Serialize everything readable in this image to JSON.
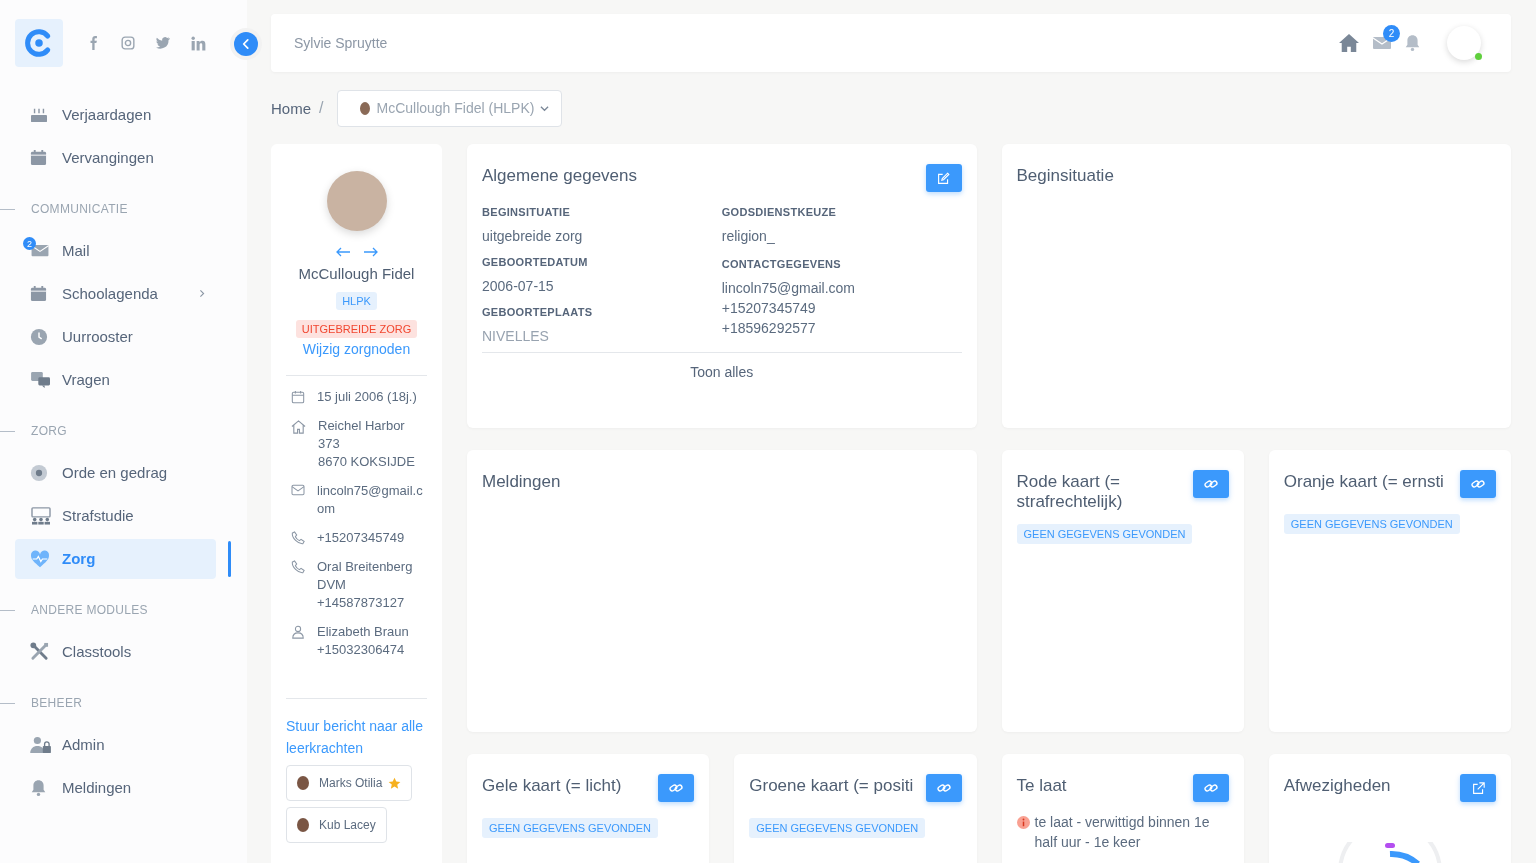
{
  "sidebar": {
    "sections": [
      {
        "items": [
          {
            "label": "Verjaardagen",
            "selected": false
          },
          {
            "label": "Vervangingen",
            "selected": false
          }
        ]
      },
      {
        "heading": "COMMUNICATIE",
        "items": [
          {
            "label": "Mail",
            "selected": false,
            "badge": "2"
          },
          {
            "label": "Schoolagenda",
            "selected": false,
            "submenu": true
          },
          {
            "label": "Uurrooster",
            "selected": false
          },
          {
            "label": "Vragen",
            "selected": false
          }
        ]
      },
      {
        "heading": "ZORG",
        "items": [
          {
            "label": "Orde en gedrag",
            "selected": false
          },
          {
            "label": "Strafstudie",
            "selected": false
          },
          {
            "label": "Zorg",
            "selected": true
          }
        ]
      },
      {
        "heading": "ANDERE MODULES",
        "items": [
          {
            "label": "Classtools",
            "selected": false
          }
        ]
      },
      {
        "heading": "BEHEER",
        "items": [
          {
            "label": "Admin",
            "selected": false
          },
          {
            "label": "Meldingen",
            "selected": false
          }
        ]
      }
    ]
  },
  "topbar": {
    "user": "Sylvie Spruytte",
    "mail_badge": "2"
  },
  "breadcrumb": {
    "home": "Home",
    "separator": "/",
    "student": "McCullough Fidel (HLPK)"
  },
  "profile": {
    "name": "McCullough Fidel",
    "class": "HLPK",
    "care_level": "UITGEBREIDE ZORG",
    "care_link": "Wijzig zorgnoden",
    "details": [
      {
        "kind": "date",
        "lines": [
          "15 juli 2006 (18j.)"
        ]
      },
      {
        "kind": "home",
        "lines": [
          "Reichel Harbor 373",
          "8670 KOKSIJDE"
        ]
      },
      {
        "kind": "mail",
        "lines": [
          "lincoln75@gmail.com"
        ]
      },
      {
        "kind": "phone",
        "lines": [
          "+15207345749"
        ]
      },
      {
        "kind": "phone",
        "lines": [
          "Oral Breitenberg DVM",
          "+14587873127"
        ]
      },
      {
        "kind": "person",
        "lines": [
          "Elizabeth Braun",
          "+15032306474"
        ]
      }
    ],
    "message_link": "Stuur bericht naar alle leerkrachten",
    "teachers": [
      {
        "name": "Marks Otilia",
        "starred": true
      },
      {
        "name": "Kub Lacey",
        "starred": false
      }
    ]
  },
  "general": {
    "title": "Algemene gegevens",
    "left": [
      {
        "label": "BEGINSITUATIE",
        "values": [
          "uitgebreide zorg"
        ]
      },
      {
        "label": "GEBOORTEDATUM",
        "values": [
          "2006-07-15"
        ]
      },
      {
        "label": "GEBOORTEPLAATS",
        "values": [
          "NIVELLES"
        ]
      }
    ],
    "right": [
      {
        "label": "GODSDIENSTKEUZE",
        "values": [
          "religion_"
        ]
      },
      {
        "label": "CONTACTGEGEVENS",
        "values": [
          "lincoln75@gmail.com",
          "+15207345749",
          "+18596292577"
        ]
      }
    ],
    "show_all": "Toon alles"
  },
  "beginsituatie": {
    "title": "Beginsituatie"
  },
  "meldingen": {
    "title": "Meldingen"
  },
  "cards": [
    {
      "kind": "list",
      "title": "Rode kaart (= strafrechtelijk)",
      "button": {
        "kind": "link"
      },
      "empty": "GEEN GEGEVENS GEVONDEN"
    },
    {
      "kind": "list",
      "title": "Oranje kaart (= ernsti",
      "button": {
        "kind": "link"
      },
      "empty": "GEEN GEGEVENS GEVONDEN"
    },
    {
      "kind": "list",
      "title": "Gele kaart (= licht)",
      "button": {
        "kind": "link"
      },
      "empty": "GEEN GEGEVENS GEVONDEN"
    },
    {
      "kind": "list",
      "title": "Groene kaart (= positi",
      "button": {
        "kind": "link"
      },
      "empty": "GEEN GEGEVENS GEVONDEN"
    },
    {
      "kind": "list",
      "title": "Te laat",
      "button": {
        "kind": "link"
      },
      "entries": [
        "te laat - verwittigd binnen 1e half uur - 1e keer"
      ]
    },
    {
      "kind": "donut",
      "title": "Afwezigheden",
      "button": {
        "kind": "external"
      }
    }
  ]
}
